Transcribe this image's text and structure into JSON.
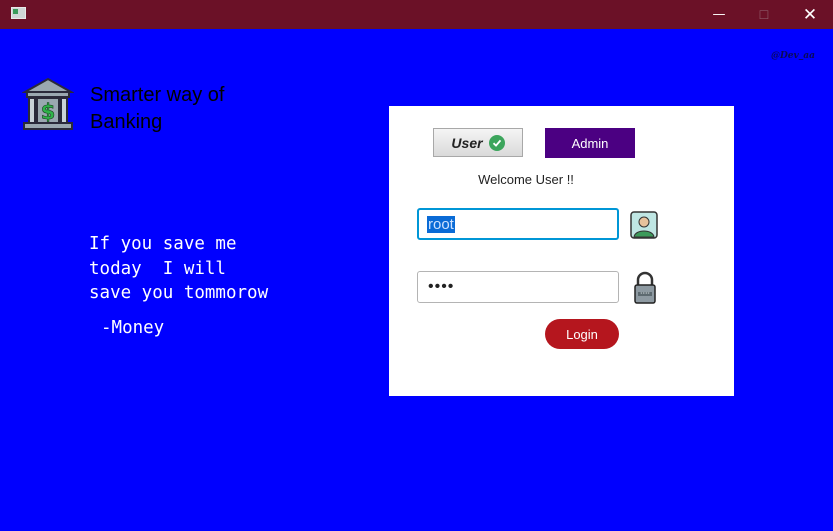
{
  "window": {
    "minimize_glyph": "—",
    "maximize_glyph": "☐",
    "close_glyph": "✕"
  },
  "watermark": "@Dev_aa",
  "brand": {
    "tagline": "Smarter way of Banking",
    "logo_icon": "bank-dollar-icon"
  },
  "quote": {
    "text": "If you save me\ntoday  I will\nsave you tommorow",
    "author": "-Money"
  },
  "login": {
    "user_tab_label": "User",
    "admin_tab_label": "Admin",
    "welcome": "Welcome User !!",
    "username_value": "root",
    "password_value": "••••",
    "login_button_label": "Login"
  },
  "colors": {
    "background": "#0000ff",
    "titlebar": "#6b1127",
    "admin_tab": "#4b0082",
    "login_button": "#b5161e",
    "focus_border": "#0096d6"
  }
}
